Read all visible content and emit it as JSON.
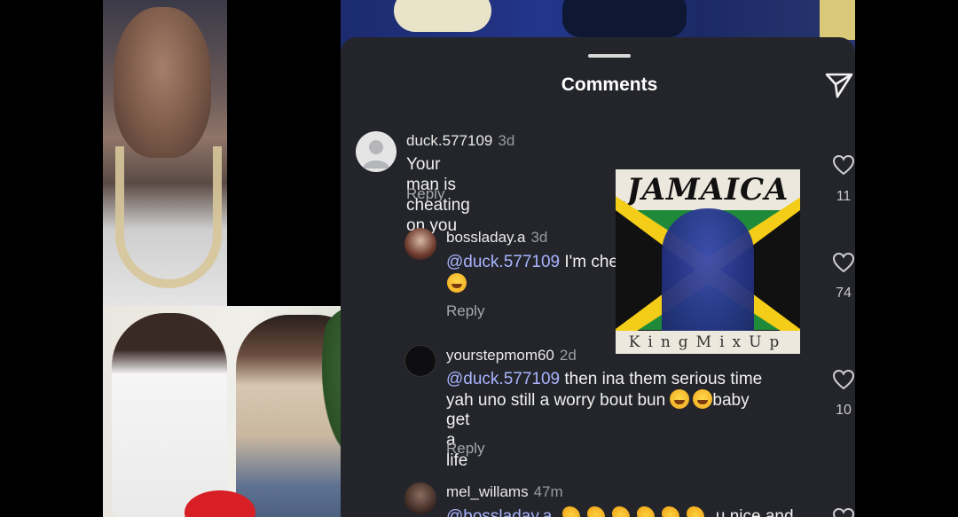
{
  "panel": {
    "title": "Comments",
    "share_icon": "paper-plane-icon"
  },
  "comments": [
    {
      "username": "duck.577109",
      "time": "3d",
      "text": "Your man is cheating on you",
      "emoji": "joy-emoji",
      "reply_label": "Reply",
      "likes": "11"
    },
    {
      "username": "bossladay.a",
      "time": "3d",
      "mention": "@duck.577109",
      "text": "I'm cheating too so we equal",
      "emoji": "wink-tongue-emoji",
      "reply_label": "Reply",
      "likes": "74"
    },
    {
      "username": "yourstepmom60",
      "time": "2d",
      "mention": "@duck.577109",
      "text_line1": "then ina them serious time",
      "text_line2a": "yah uno still a worry bout bun",
      "text_line2b": "baby",
      "text_line3": "get a life",
      "emoji": "joy-emoji",
      "reply_label": "Reply",
      "likes": "10"
    },
    {
      "username": "mel_willams",
      "time": "47m",
      "mention": "@bossladay.a",
      "text": "u nice and",
      "emoji": "clapping-hands-emoji"
    }
  ],
  "logo": {
    "title": "JAMAICA",
    "subtitle": "KingMixUp"
  },
  "colors": {
    "panel_bg": "#24252a",
    "mention": "#a9b4ff",
    "secondary_text": "#a7a8ad"
  }
}
